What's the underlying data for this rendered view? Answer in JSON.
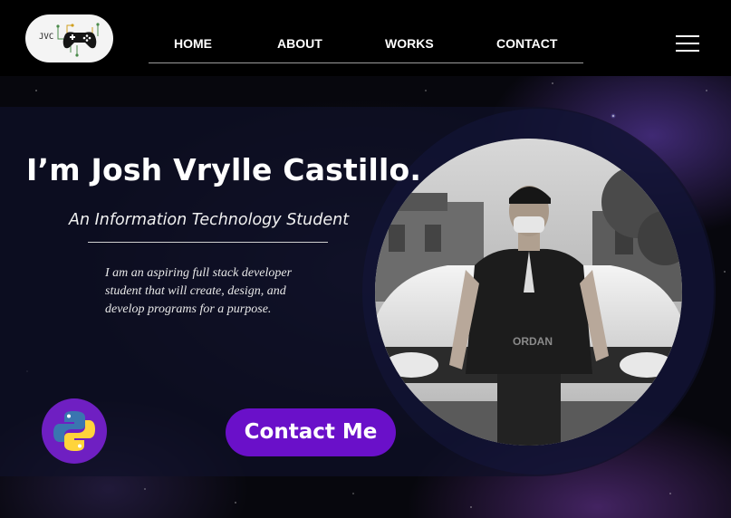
{
  "header": {
    "logo_text": "JVC",
    "nav": [
      {
        "label": "HOME"
      },
      {
        "label": "ABOUT"
      },
      {
        "label": "WORKS"
      },
      {
        "label": "CONTACT"
      }
    ],
    "menu_icon": "hamburger-menu-icon"
  },
  "hero": {
    "title": "I’m Josh Vrylle Castillo.",
    "subtitle": "An Information Technology Student",
    "description_lines": [
      "I am an aspiring full stack developer",
      "student that will create, design, and",
      "develop programs for a purpose."
    ],
    "contact_button": "Contact Me",
    "badge_icon": "python-logo-icon",
    "photo": "profile-photo"
  },
  "colors": {
    "accent_purple": "#6a10c9",
    "header_bg": "#000000",
    "python_blue": "#3a75b0",
    "python_yellow": "#ffd43b"
  }
}
